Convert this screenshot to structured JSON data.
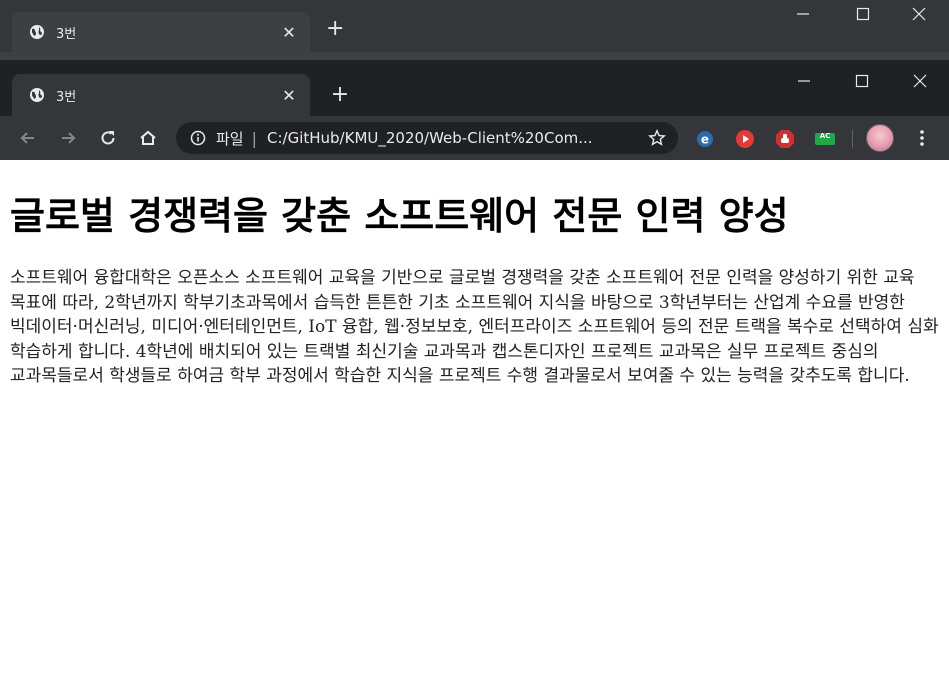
{
  "back_window": {
    "tab_title": "3번"
  },
  "window": {
    "tab_title": "3번",
    "new_tab_label": "+"
  },
  "toolbar": {
    "scheme_label": "파일",
    "url": "C:/GitHub/KMU_2020/Web-Client%20Com..."
  },
  "extensions": [
    {
      "name": "e-extension-icon"
    },
    {
      "name": "youtube-play-extension-icon"
    },
    {
      "name": "stop-hand-extension-icon"
    },
    {
      "name": "ac-extension-icon",
      "label": "AC"
    }
  ],
  "colors": {
    "chrome_dark": "#202124",
    "chrome_tab": "#35363a",
    "chrome_text": "#e8eaed",
    "page_bg": "#ffffff"
  },
  "page": {
    "heading": "글로벌 경쟁력을 갖춘 소프트웨어 전문 인력 양성",
    "paragraph": "소프트웨어 융합대학은 오픈소스 소프트웨어 교육을 기반으로 글로벌 경쟁력을 갖춘 소프트웨어 전문 인력을 양성하기 위한 교육 목표에 따라, 2학년까지 학부기초과목에서 습득한 튼튼한 기초 소프트웨어 지식을 바탕으로 3학년부터는 산업계 수요를 반영한 빅데이터·머신러닝, 미디어·엔터테인먼트, IoT 융합, 웹·정보보호, 엔터프라이즈 소프트웨어 등의 전문 트랙을 복수로 선택하여 심화 학습하게 합니다. 4학년에 배치되어 있는 트랙별 최신기술 교과목과 캡스톤디자인 프로젝트 교과목은 실무 프로젝트 중심의 교과목들로서 학생들로 하여금 학부 과정에서 학습한 지식을 프로젝트 수행 결과물로서 보여줄 수 있는 능력을 갖추도록 합니다."
  }
}
